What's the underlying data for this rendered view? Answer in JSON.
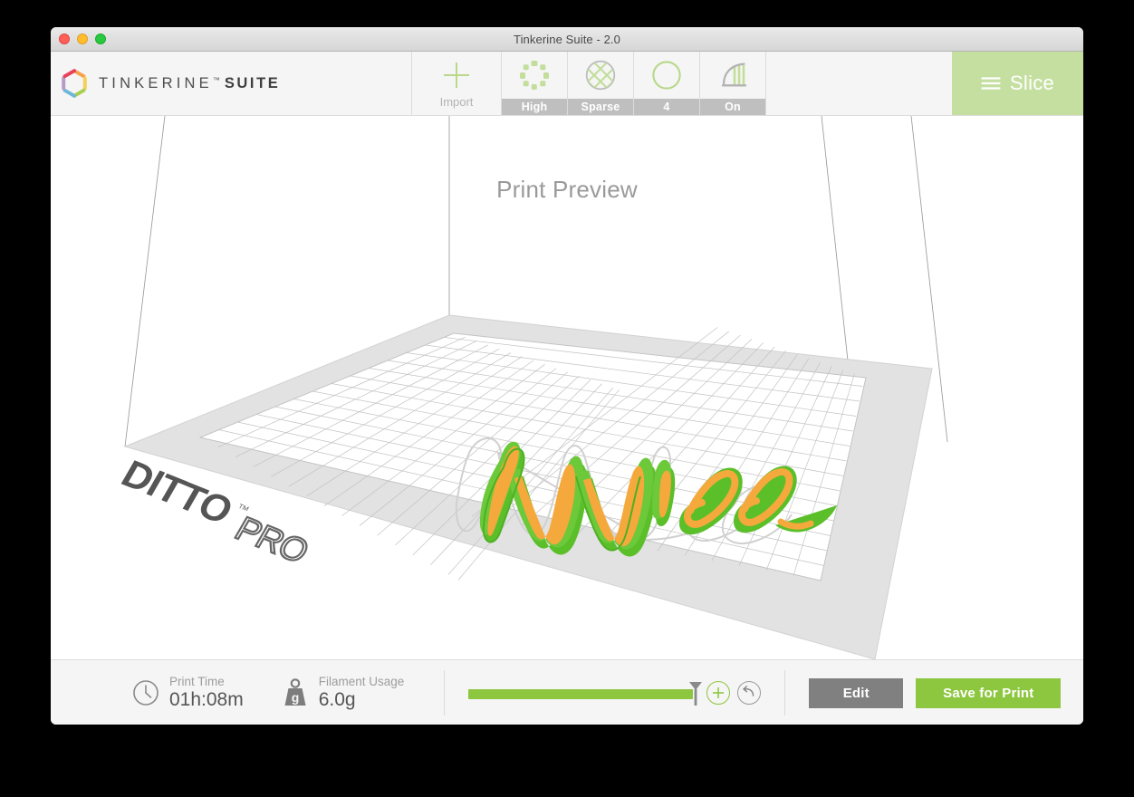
{
  "window": {
    "title": "Tinkerine Suite - 2.0",
    "traffic_lights": [
      "close",
      "minimize",
      "maximize"
    ]
  },
  "brand": {
    "logo_icon": "tinkerine-hexagon-logo",
    "name": "TINKERINE",
    "trademark": "™",
    "product": "SUITE"
  },
  "toolbar": {
    "import": {
      "icon": "plus-icon",
      "label": "Import"
    },
    "settings": [
      {
        "name": "quality",
        "icon": "quality-dots-icon",
        "value": "High"
      },
      {
        "name": "infill",
        "icon": "infill-crosshatch-icon",
        "value": "Sparse"
      },
      {
        "name": "shells",
        "icon": "shell-circle-icon",
        "value": "4"
      },
      {
        "name": "support",
        "icon": "support-arc-icon",
        "value": "On"
      }
    ],
    "slice": {
      "icon": "hamburger-icon",
      "label": "Slice"
    }
  },
  "viewport": {
    "title": "Print Preview",
    "bed_brand": "DITTO",
    "bed_brand_tm": "™",
    "bed_brand_suffix": "PRO",
    "model_text": "Will",
    "colors": {
      "perimeter": "#5bbf2a",
      "infill": "#f5a93c",
      "bed": "#e0e0e0",
      "grid": "#b9b9b9",
      "accent_green": "#8dc63f",
      "slice_bg": "#c5dfa0"
    }
  },
  "status": {
    "print_time": {
      "icon": "clock-icon",
      "label": "Print Time",
      "value": "01h:08m"
    },
    "filament_usage": {
      "icon": "weight-icon",
      "icon_text": "g",
      "label": "Filament Usage",
      "value": "6.0g"
    },
    "layer_slider": {
      "name": "layer-slider",
      "fill_percent": 100,
      "add_icon": "plus-circle-icon",
      "reset_icon": "undo-circle-icon"
    },
    "edit_label": "Edit",
    "save_label": "Save for Print"
  }
}
